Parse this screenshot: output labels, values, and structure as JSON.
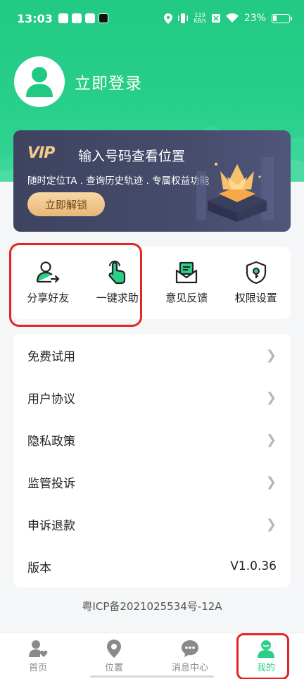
{
  "status_bar": {
    "time": "13:03",
    "net_speed": "119",
    "net_unit": "KB/s",
    "battery": "23%"
  },
  "profile": {
    "login_label": "立即登录"
  },
  "vip": {
    "logo": "VIP",
    "title": "输入号码查看位置",
    "subtitle": "随时定位TA . 查询历史轨迹 . 专属权益功能",
    "button": "立即解锁"
  },
  "quick_actions": [
    {
      "label": "分享好友",
      "icon": "share-user-icon"
    },
    {
      "label": "一键求助",
      "icon": "tap-hand-icon"
    },
    {
      "label": "意见反馈",
      "icon": "feedback-mail-icon"
    },
    {
      "label": "权限设置",
      "icon": "shield-lock-icon"
    }
  ],
  "menu": [
    {
      "label": "免费试用"
    },
    {
      "label": "用户协议"
    },
    {
      "label": "隐私政策"
    },
    {
      "label": "监管投诉"
    },
    {
      "label": "申诉退款"
    },
    {
      "label": "版本",
      "value": "V1.0.36"
    }
  ],
  "icp": "粤ICP备2021025534号-12A",
  "bottom_nav": [
    {
      "label": "首页",
      "icon": "home-heart-icon"
    },
    {
      "label": "位置",
      "icon": "location-pin-icon"
    },
    {
      "label": "消息中心",
      "icon": "chat-bubble-icon"
    },
    {
      "label": "我的",
      "icon": "profile-icon",
      "active": true
    }
  ],
  "colors": {
    "accent": "#2ccf8a",
    "highlight": "#e32525",
    "vip_gold": "#f4c98c"
  }
}
